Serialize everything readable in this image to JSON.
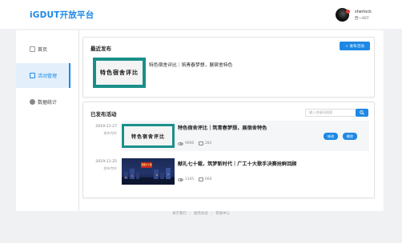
{
  "header": {
    "logo": "iGDUT开放平台",
    "user_name": "sherlock",
    "user_sub": "西一407"
  },
  "sidebar": {
    "items": [
      {
        "label": "首页",
        "icon": "document-icon"
      },
      {
        "label": "活动管理",
        "icon": "list-icon"
      },
      {
        "label": "数据统计",
        "icon": "pie-chart-icon"
      }
    ],
    "active_index": 1
  },
  "recent": {
    "title": "最近发布",
    "publish_button": "+ 发布活动",
    "item": {
      "thumb_text": "特色宿舍评比",
      "title": "特色宿舍评比｜筑青春梦想，展宿舍特色"
    }
  },
  "published": {
    "title": "已发布活动",
    "search_placeholder": "输入关键词搜索",
    "rows": [
      {
        "date": "2019-11-27",
        "status": "发布完毕",
        "thumb_text": "特色宿舍评比",
        "title": "特色宿舍评比｜筑青春梦想，展宿舍特色",
        "views": "9666",
        "comments": "284",
        "edit_label": "修改",
        "delete_label": "删除"
      },
      {
        "date": "2019-11-25",
        "status": "发布完毕",
        "thumb_text": "致敬七十载",
        "title": "献礼七十载，筑梦新时代｜广工十大歌手决赛抢鲜回顾",
        "views": "1345",
        "comments": "666"
      }
    ]
  },
  "footer": {
    "links": [
      "关于我们",
      "服务协议",
      "帮助中心"
    ]
  },
  "colors": {
    "accent": "#1e88e5",
    "thumb_teal": "#1a8f8a"
  }
}
